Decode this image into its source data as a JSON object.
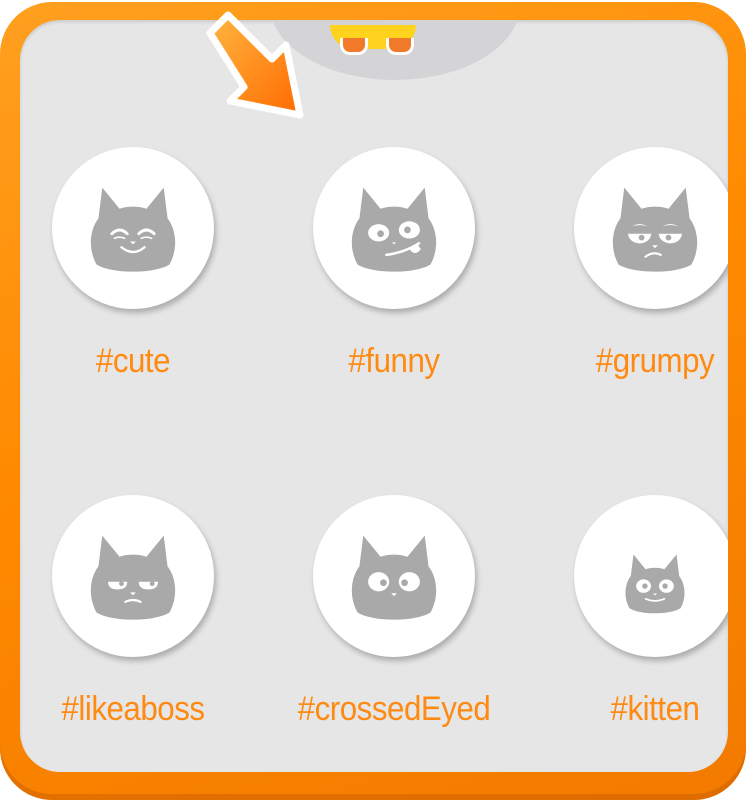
{
  "colors": {
    "frame": "#ff8a00",
    "panel": "#e6e6e7",
    "label": "#ff8a12",
    "cat_face": "#a9a9aa"
  },
  "header": {
    "icon": "arrow-down-right-icon"
  },
  "moods": [
    {
      "label": "#cute",
      "icon": "cat-cute-icon"
    },
    {
      "label": "#funny",
      "icon": "cat-funny-icon"
    },
    {
      "label": "#grumpy",
      "icon": "cat-grumpy-icon"
    },
    {
      "label": "#likeaboss",
      "icon": "cat-likeaboss-icon"
    },
    {
      "label": "#crossedEyed",
      "icon": "cat-crossed-eyed-icon"
    },
    {
      "label": "#kitten",
      "icon": "cat-kitten-icon"
    }
  ]
}
